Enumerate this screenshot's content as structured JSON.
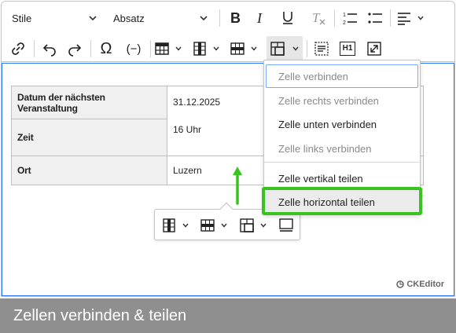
{
  "toolbar": {
    "style_dropdown": "Stile",
    "heading_dropdown": "Absatz",
    "icons": [
      "bold-icon",
      "italic-icon",
      "underline-icon",
      "remove-format-icon",
      "numbered-list-icon",
      "bulleted-list-icon",
      "align-icon",
      "link-icon",
      "undo-icon",
      "redo-icon",
      "special-chars-icon",
      "placeholder-icon",
      "insert-table-icon",
      "table-column-icon",
      "table-row-icon",
      "merge-cells-icon",
      "source-icon",
      "heading-h1-icon",
      "fullscreen-icon"
    ],
    "h1_label": "H1",
    "omega": "Ω",
    "paren": "(−)"
  },
  "table": {
    "rows": [
      {
        "label": "Datum der nächsten Veranstaltung",
        "value": "31.12.2025"
      },
      {
        "label": "Zeit",
        "value": "16 Uhr"
      },
      {
        "label": "Ort",
        "value": "Luzern"
      }
    ]
  },
  "merge_menu": {
    "items": [
      {
        "label": "Zelle verbinden",
        "state": "disabled-focused"
      },
      {
        "label": "Zelle rechts verbinden",
        "state": "disabled"
      },
      {
        "label": "Zelle unten verbinden",
        "state": "enabled"
      },
      {
        "label": "Zelle links verbinden",
        "state": "disabled"
      },
      {
        "label": "Zelle vertikal teilen",
        "state": "enabled"
      },
      {
        "label": "Zelle horizontal teilen",
        "state": "highlighted"
      }
    ]
  },
  "branding": {
    "label": "CKEditor"
  },
  "caption": {
    "text": "Zellen verbinden & teilen"
  },
  "colors": {
    "highlight_green": "#38c41f",
    "focus_blue": "#2977ff",
    "caption_bg": "#8f8f8f"
  }
}
